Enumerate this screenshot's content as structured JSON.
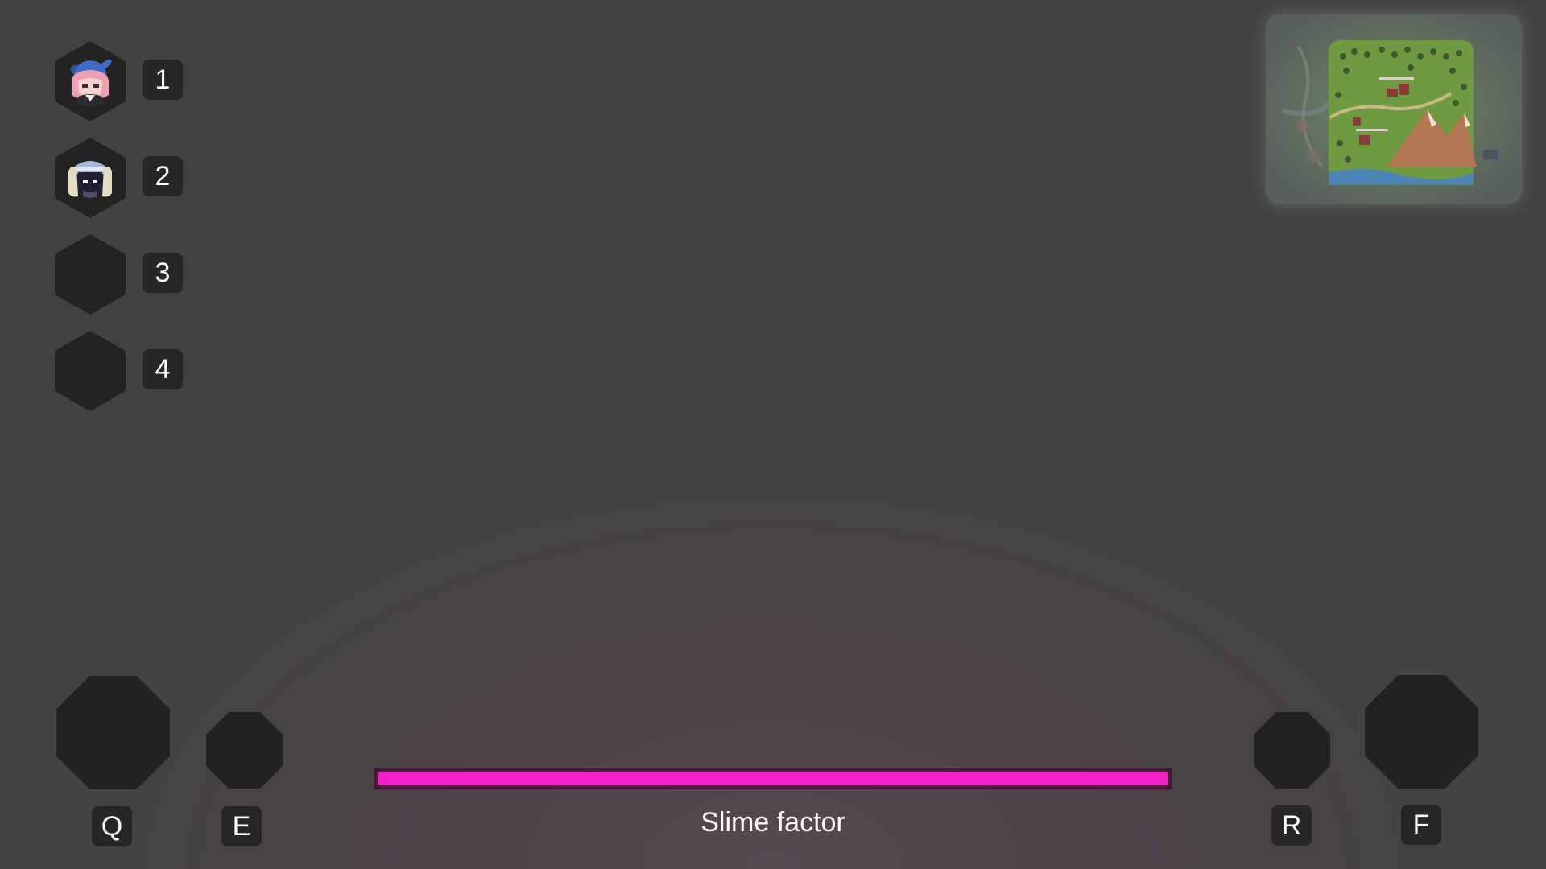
{
  "party": {
    "slots": [
      {
        "key": "1",
        "portrait": "pink-haired-character-portrait",
        "filled": true
      },
      {
        "key": "2",
        "portrait": "horned-helmet-character-portrait",
        "filled": true
      },
      {
        "key": "3",
        "portrait": "",
        "filled": false
      },
      {
        "key": "4",
        "portrait": "",
        "filled": false
      }
    ]
  },
  "abilities": {
    "q": {
      "key": "Q"
    },
    "e": {
      "key": "E"
    },
    "r": {
      "key": "R"
    },
    "f": {
      "key": "F"
    }
  },
  "slime": {
    "label": "Slime factor",
    "fill_fraction": 1.0,
    "color": "#f21fc7"
  },
  "minimap": {
    "icon": "world-map-icon"
  },
  "colors": {
    "slot_background": "#232323",
    "slime_bar": "#f21fc7"
  }
}
